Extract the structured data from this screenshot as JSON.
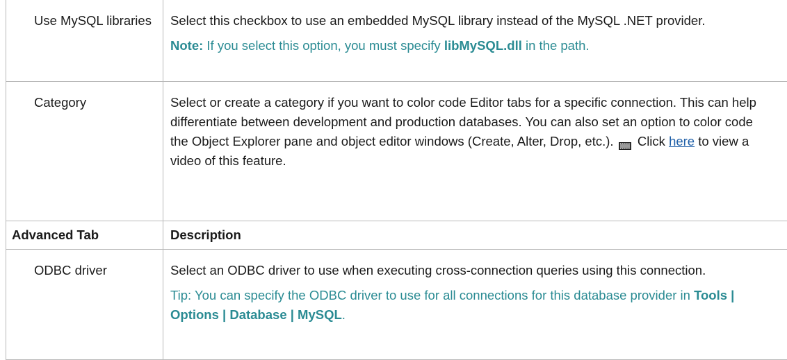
{
  "rows": [
    {
      "label": "Use MySQL libraries",
      "desc_text": "Select this checkbox to use an embedded MySQL library instead of the MySQL .NET provider.",
      "note_prefix": "Note:",
      "note_text_1": " If you select this option, you must specify ",
      "note_bold": "libMySQL.dll",
      "note_text_2": " in the path."
    },
    {
      "label": "Category",
      "desc_text": "Select or create a category if you want to color code Editor tabs for a specific connection. This can help differentiate between development and production databases. You can also set an option to color code the Object Explorer pane and object editor windows (Create, Alter, Drop, etc.).",
      "video_icon": "video-icon",
      "click_text": " Click ",
      "link_text": "here",
      "after_link": " to view a video of this feature."
    }
  ],
  "header": {
    "col1": "Advanced Tab",
    "col2": "Description"
  },
  "advanced_rows": [
    {
      "label": "ODBC driver",
      "desc_text": "Select an ODBC driver to use when executing cross-connection queries using this connection.",
      "tip_text": "Tip: You can specify the ODBC driver to use for all connections for this database provider in ",
      "tip_bold": "Tools | Options | Database | MySQL",
      "tip_end": "."
    }
  ],
  "colors": {
    "note_teal": "#2a8b93",
    "link_blue": "#1f5fa8",
    "border": "#b9b9b9"
  }
}
